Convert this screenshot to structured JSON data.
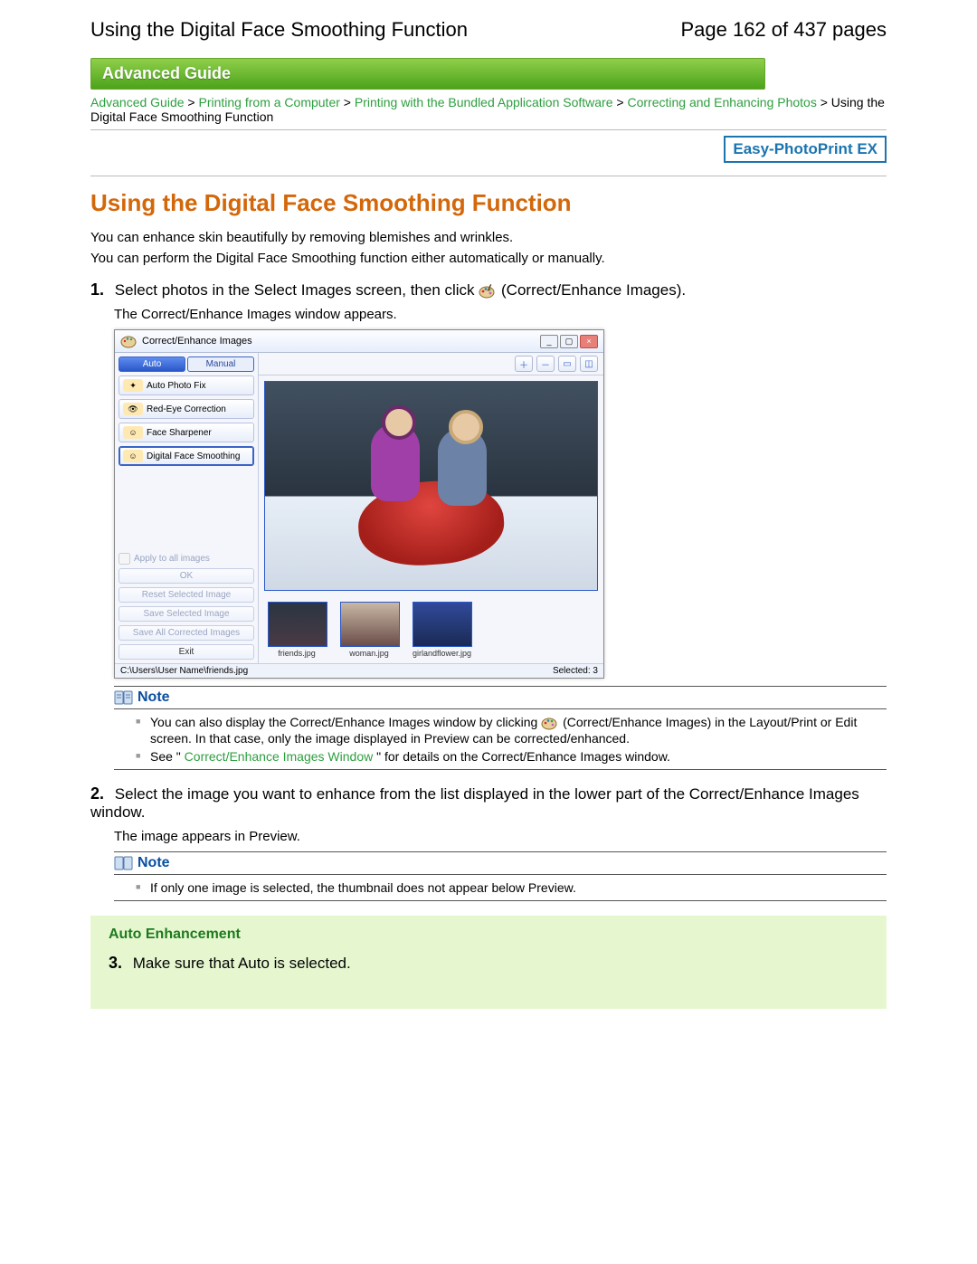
{
  "header": {
    "title": "Using the Digital Face Smoothing Function",
    "page_label": "Page 162 of 437 pages"
  },
  "adv_bar": "Advanced Guide",
  "breadcrumbs": {
    "c1": "Advanced Guide",
    "sep": " > ",
    "c2": "Printing from a Computer",
    "c3": "Printing with the Bundled Application Software",
    "c4": "Correcting and Enhancing Photos",
    "c5": "Using the Digital Face Smoothing Function"
  },
  "product_box": "Easy-PhotoPrint EX",
  "h1": "Using the Digital Face Smoothing Function",
  "intro": {
    "p1": "You can enhance skin beautifully by removing blemishes and wrinkles.",
    "p2": "You can perform the Digital Face Smoothing function either automatically or manually."
  },
  "steps": {
    "s1": {
      "num": "1.",
      "title_before": "Select photos in the Select Images screen, then click ",
      "title_after": " (Correct/Enhance Images).",
      "desc": "The Correct/Enhance Images window appears."
    },
    "s2": {
      "num": "2.",
      "title": "Select the image you want to enhance from the list displayed in the lower part of the Correct/Enhance Images window.",
      "desc": "The image appears in Preview."
    },
    "s3": {
      "num": "3.",
      "title": "Make sure that Auto is selected."
    }
  },
  "app_window": {
    "title": "Correct/Enhance Images",
    "tabs": {
      "auto": "Auto",
      "manual": "Manual"
    },
    "side_buttons": {
      "b1": "Auto Photo Fix",
      "b2": "Red-Eye Correction",
      "b3": "Face Sharpener",
      "b4": "Digital Face Smoothing"
    },
    "apply_all": "Apply to all images",
    "ok": "OK",
    "reset": "Reset Selected Image",
    "save_sel": "Save Selected Image",
    "save_all": "Save All Corrected Images",
    "exit": "Exit",
    "toolbar": {
      "zoom_in": "zoom-in-icon",
      "zoom_out": "zoom-out-icon",
      "fit": "fit-window-icon",
      "compare": "compare-icon"
    },
    "thumbs": {
      "t1": "friends.jpg",
      "t2": "woman.jpg",
      "t3": "girlandflower.jpg"
    },
    "status_path": "C:\\Users\\User Name\\friends.jpg",
    "status_sel": "Selected: 3"
  },
  "note_label": "Note",
  "note1": {
    "li1_before": "You can also display the Correct/Enhance Images window by clicking ",
    "li1_after": " (Correct/Enhance Images) in the Layout/Print or Edit screen. In that case, only the image displayed in Preview can be corrected/enhanced.",
    "li2_before": "See \"",
    "li2_link": "Correct/Enhance Images Window",
    "li2_after": " \" for details on the Correct/Enhance Images window."
  },
  "note2": {
    "li1": "If only one image is selected, the thumbnail does not appear below Preview."
  },
  "auto_section": {
    "title": "Auto Enhancement"
  }
}
